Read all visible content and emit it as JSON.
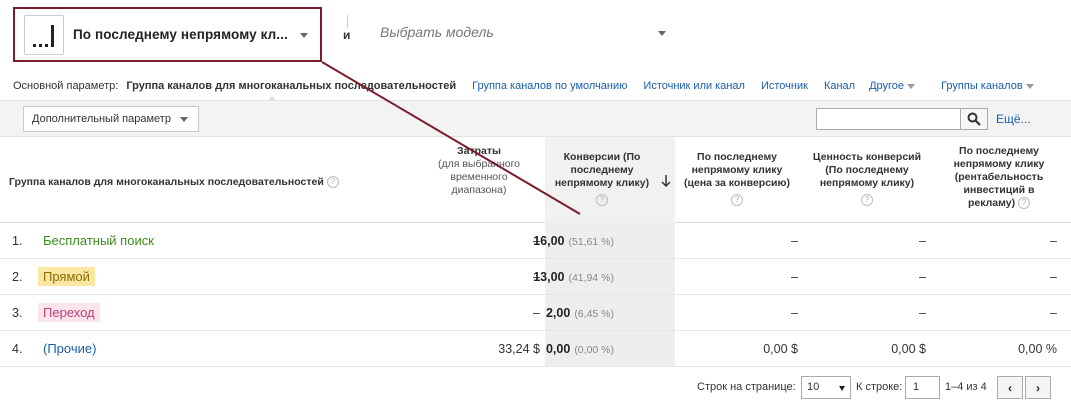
{
  "model_selector": {
    "current": "По последнему непрямому кл...",
    "and_label": "и",
    "second_placeholder": "Выбрать модель"
  },
  "dimensions": {
    "label": "Основной параметр:",
    "active": "Группа каналов для многоканальных последовательностей",
    "links": [
      "Группа каналов по умолчанию",
      "Источник или канал",
      "Источник",
      "Канал",
      "Другое",
      "Группы каналов"
    ]
  },
  "toolbar": {
    "secondary_dimension": "Дополнительный параметр",
    "search_value": "",
    "more": "Ещё..."
  },
  "table": {
    "headers": {
      "channel": "Группа каналов для многоканальных последовательностей",
      "cost_title": "Затраты",
      "cost_sub": "(для выбранного временного диапазона)",
      "conversions": "Конверсии (По последнему непрямому клику)",
      "cpa": "По последнему непрямому клику (цена за конверсию)",
      "value": "Ценность конверсий (По последнему непрямому клику)",
      "roi": "По последнему непрямому клику (рентабельность инвестиций в рекламу)"
    },
    "rows": [
      {
        "num": "1.",
        "channel": "Бесплатный поиск",
        "cost": "–",
        "conv": "16,00",
        "pct": "(51,61 %)",
        "cpa": "–",
        "value": "–",
        "roi": "–"
      },
      {
        "num": "2.",
        "channel": "Прямой",
        "cost": "–",
        "conv": "13,00",
        "pct": "(41,94 %)",
        "cpa": "–",
        "value": "–",
        "roi": "–"
      },
      {
        "num": "3.",
        "channel": "Переход",
        "cost": "–",
        "conv": "2,00",
        "pct": "(6,45 %)",
        "cpa": "–",
        "value": "–",
        "roi": "–"
      },
      {
        "num": "4.",
        "channel": "(Прочие)",
        "cost": "33,24 $",
        "conv": "0,00",
        "pct": "(0,00 %)",
        "cpa": "0,00 $",
        "value": "0,00 $",
        "roi": "0,00 %"
      }
    ],
    "channel_colors": {
      "row0_bg": "#ffffff",
      "row0_fg": "#3c8b1d",
      "row1_bg": "#fbe7a1",
      "row1_fg": "#8a6d00",
      "row2_bg": "#fbe4ec",
      "row2_fg": "#b8407a",
      "row3_bg": "#ffffff",
      "row3_fg": "#1a5eab"
    }
  },
  "pagination": {
    "rows_label": "Строк на странице:",
    "rows_value": "10",
    "goto_label": "К строке:",
    "goto_value": "1",
    "range": "1–4 из 4",
    "prev": "‹",
    "next": "›"
  },
  "accent": "#7a1c2c"
}
